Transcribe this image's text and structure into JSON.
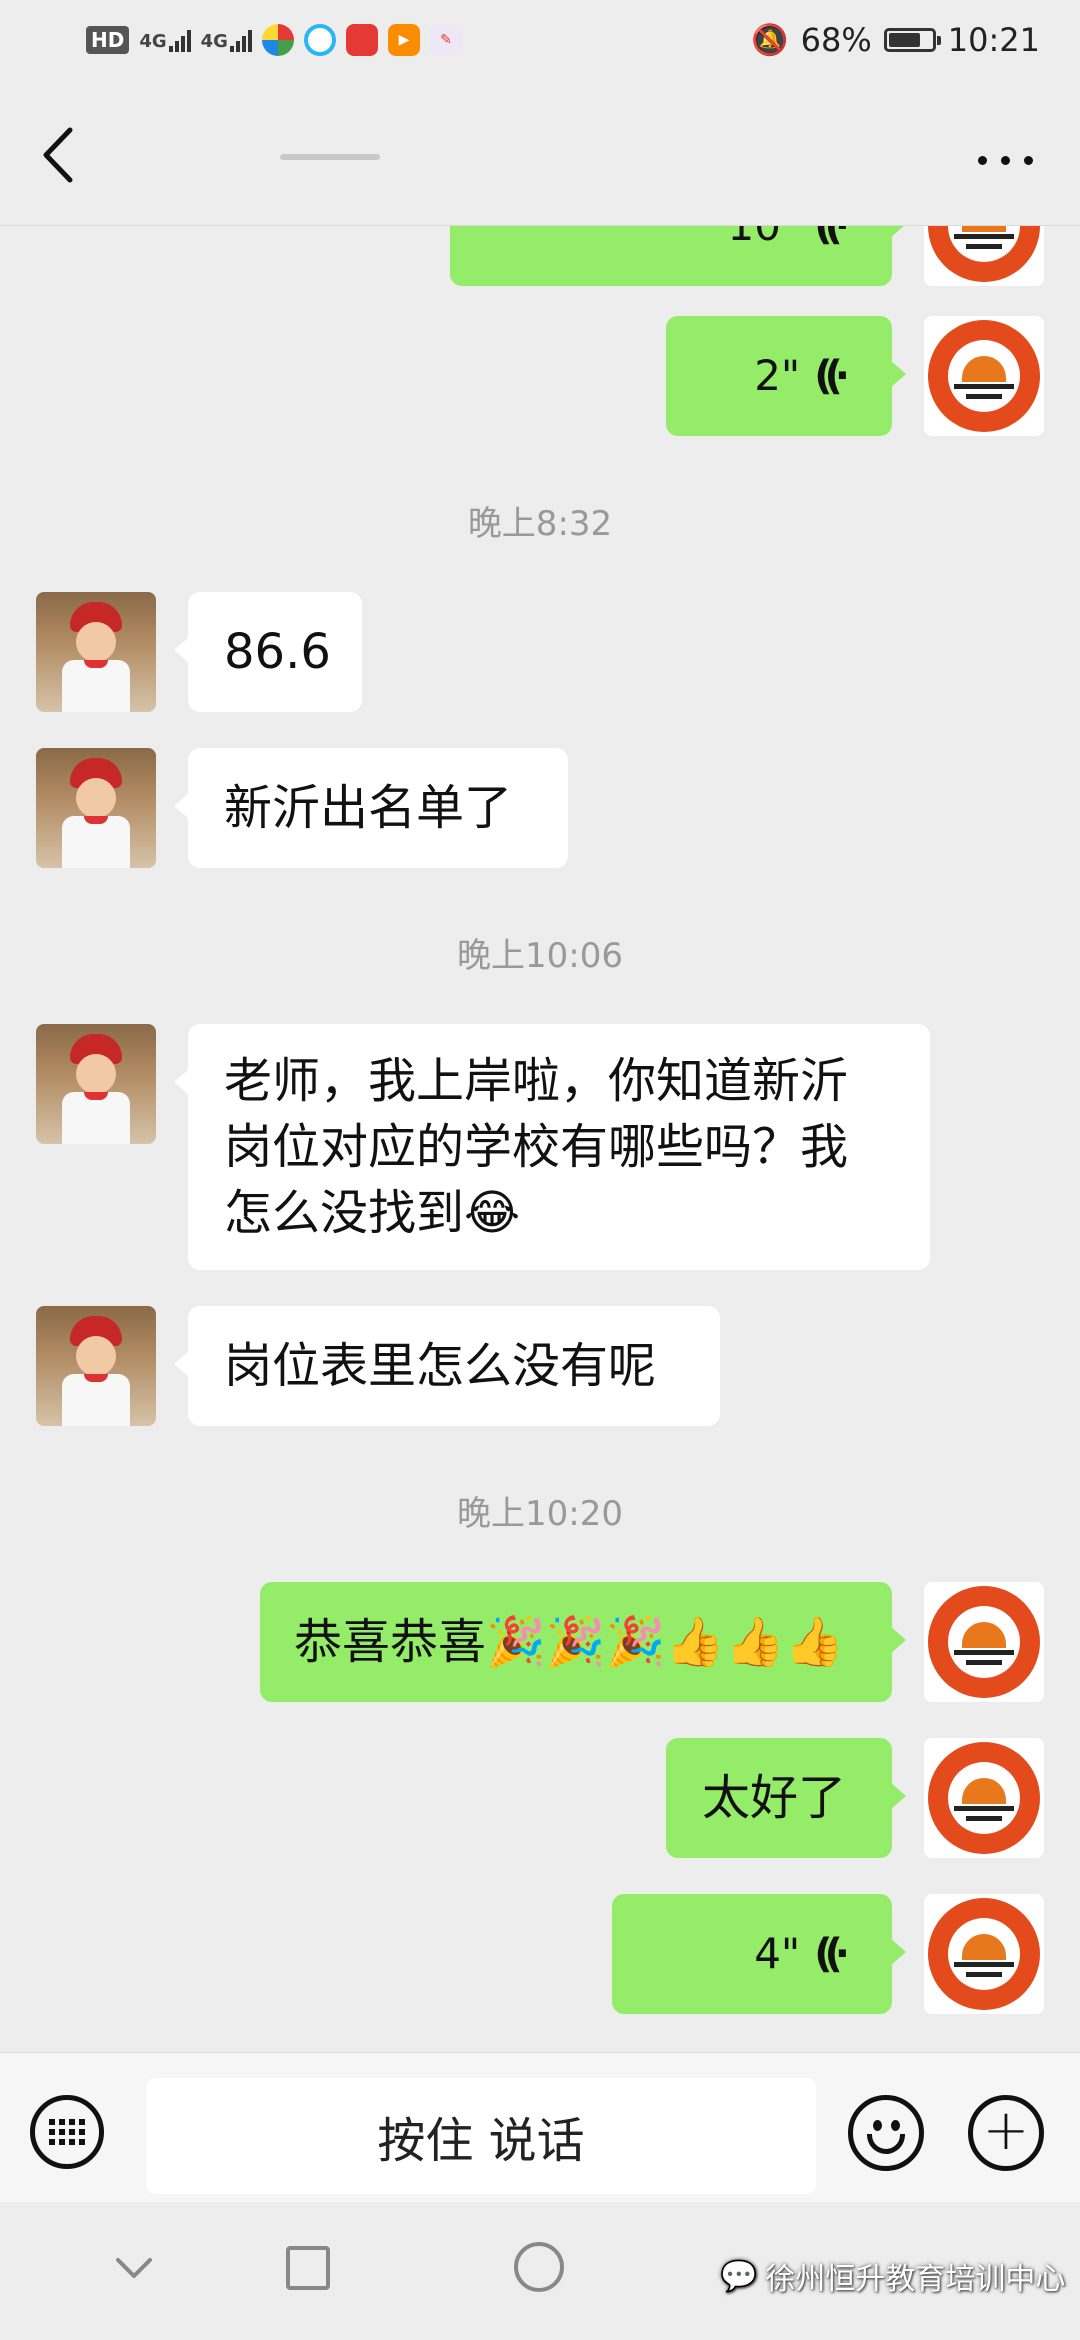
{
  "status_bar": {
    "hd_label": "HD",
    "net1": "4G",
    "net2": "4G",
    "battery_text": "68%",
    "battery_level": 0.68,
    "time": "10:21"
  },
  "titlebar": {
    "back_icon": "chevron-left-icon",
    "more_icon": "more-dots-icon"
  },
  "chat": {
    "messages": [
      {
        "side": "right",
        "type": "voice",
        "duration": "10\""
      },
      {
        "side": "right",
        "type": "voice",
        "duration": "2\""
      },
      {
        "type": "time",
        "text": "晚上8:32"
      },
      {
        "side": "left",
        "type": "text",
        "text": "86.6"
      },
      {
        "side": "left",
        "type": "text",
        "text": "新沂出名单了"
      },
      {
        "type": "time",
        "text": "晚上10:06"
      },
      {
        "side": "left",
        "type": "text",
        "text": "老师，我上岸啦，你知道新沂岗位对应的学校有哪些吗？我怎么没找到😂"
      },
      {
        "side": "left",
        "type": "text",
        "text": "岗位表里怎么没有呢"
      },
      {
        "type": "time",
        "text": "晚上10:20"
      },
      {
        "side": "right",
        "type": "text",
        "text": "恭喜恭喜🎉🎉🎉👍👍👍"
      },
      {
        "side": "right",
        "type": "text",
        "text": "太好了"
      },
      {
        "side": "right",
        "type": "voice",
        "duration": "4\""
      }
    ]
  },
  "input_bar": {
    "talk_label": "按住 说话",
    "plus_label": "+"
  },
  "watermark": {
    "text": "徐州恒升教育培训中心"
  },
  "colors": {
    "bubble_green": "#95ec69",
    "background": "#ededed",
    "logo_red": "#e34a1c"
  }
}
